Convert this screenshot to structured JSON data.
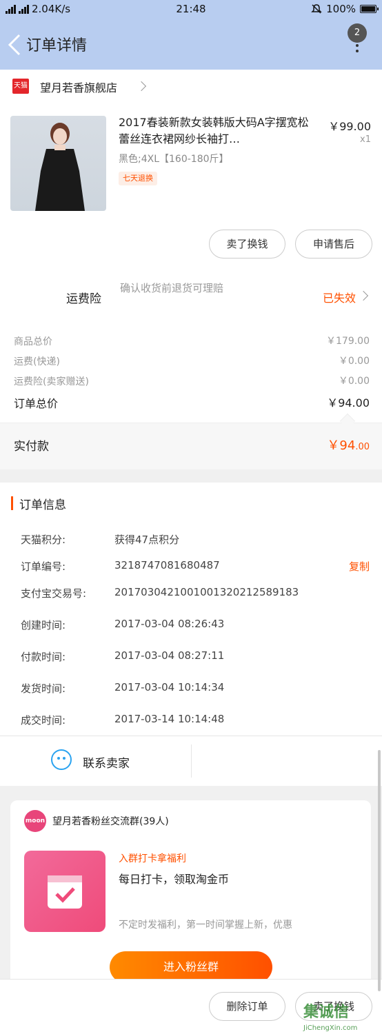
{
  "status_bar": {
    "network": "2.04K/s",
    "time": "21:48",
    "battery": "100%"
  },
  "nav": {
    "title": "订单详情",
    "badge_count": "2"
  },
  "shop": {
    "badge": "天猫",
    "name": "望月若香旗舰店"
  },
  "product": {
    "title": "2017春装新款女装韩版大码A字摆宽松蕾丝连衣裙网纱长袖打…",
    "price": "￥99.00",
    "quantity": "x1",
    "sku": "黑色;4XL【160-180斤】",
    "tag": "七天退换"
  },
  "actions": {
    "resell": "卖了换钱",
    "after_sale": "申请售后"
  },
  "shipping_insurance": {
    "label": "运费险",
    "desc": "确认收货前退货可理赔",
    "status": "已失效"
  },
  "fees": [
    {
      "label": "商品总价",
      "value": "￥179.00"
    },
    {
      "label": "运费(快递)",
      "value": "￥0.00"
    },
    {
      "label": "运费险(卖家赠送)",
      "value": "￥0.00"
    }
  ],
  "total": {
    "label": "订单总价",
    "value": "￥94.00"
  },
  "paid": {
    "label": "实付款",
    "currency_int": "￥94",
    "decimal": ".00"
  },
  "order_info": {
    "title": "订单信息",
    "copy_label": "复制",
    "rows": [
      {
        "label": "天猫积分:",
        "value": "获得47点积分"
      },
      {
        "label": "订单编号:",
        "value": "3218747081680487"
      },
      {
        "label": "支付宝交易号:",
        "value": "2017030421001001320212589183"
      },
      {
        "label": "创建时间:",
        "value": "2017-03-04 08:26:43"
      },
      {
        "label": "付款时间:",
        "value": "2017-03-04 08:27:11"
      },
      {
        "label": "发货时间:",
        "value": "2017-03-04 10:14:34"
      },
      {
        "label": "成交时间:",
        "value": "2017-03-14 10:14:48"
      }
    ]
  },
  "contact": {
    "label": "联系卖家"
  },
  "fan_group": {
    "logo": "moon",
    "title": "望月若香粉丝交流群(39人)",
    "tag": "入群打卡拿福利",
    "headline": "每日打卡，领取淘金币",
    "desc": "不定时发福利，第一时间掌握上新，优惠",
    "button": "进入粉丝群"
  },
  "bottom_bar": {
    "delete": "删除订单",
    "resell": "卖了换钱"
  },
  "watermark": {
    "main": "集诚信",
    "sub": "JiChengXin.com"
  },
  "colors": {
    "accent": "#ff5000",
    "header_bg": "#b8cdf0",
    "contact_icon": "#2aa3f0"
  }
}
